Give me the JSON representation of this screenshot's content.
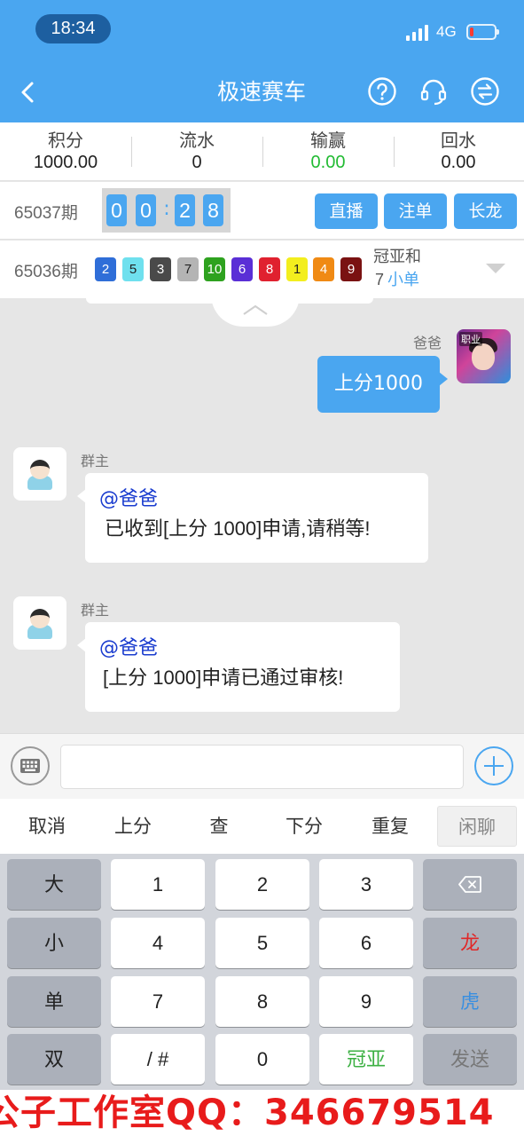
{
  "status_bar": {
    "time": "18:34",
    "network": "4G",
    "battery_level": 0.15
  },
  "header": {
    "title": "极速赛车",
    "icons": [
      "back-icon",
      "help-icon",
      "headset-icon",
      "switch-icon"
    ]
  },
  "stats": [
    {
      "label": "积分",
      "value": "1000.00"
    },
    {
      "label": "流水",
      "value": "0"
    },
    {
      "label": "输赢",
      "value": "0.00"
    },
    {
      "label": "回水",
      "value": "0.00"
    }
  ],
  "current_round": {
    "period": "65037期",
    "countdown": [
      "0",
      "0",
      "2",
      "8"
    ],
    "colon": ":",
    "buttons": [
      "直播",
      "注单",
      "长龙"
    ]
  },
  "last_round": {
    "period": "65036期",
    "balls": [
      {
        "n": "2",
        "color": "#2f6ed8"
      },
      {
        "n": "5",
        "color": "#6fe0ee"
      },
      {
        "n": "3",
        "color": "#4a4a4a"
      },
      {
        "n": "7",
        "color": "#b4b4b4"
      },
      {
        "n": "10",
        "color": "#2ea21f"
      },
      {
        "n": "6",
        "color": "#5a2fd6"
      },
      {
        "n": "8",
        "color": "#e0212f"
      },
      {
        "n": "1",
        "color": "#f3ee1e"
      },
      {
        "n": "4",
        "color": "#f08a14"
      },
      {
        "n": "9",
        "color": "#7a1212"
      }
    ],
    "sum_label": "冠亚和",
    "sum_value": "7",
    "sum_tags": "小单"
  },
  "messages": [
    {
      "sender": "爸爸",
      "side": "right",
      "text": "上分1000"
    },
    {
      "sender": "群主",
      "side": "left",
      "mention": "@爸爸",
      "text": "已收到[上分 1000]申请,请稍等!"
    },
    {
      "sender": "群主",
      "side": "left",
      "mention": "@爸爸",
      "text": "[上分 1000]申请已通过审核!"
    }
  ],
  "avatar_badge": "职业",
  "input": {
    "placeholder": ""
  },
  "quick_actions": [
    "取消",
    "上分",
    "查",
    "下分",
    "重复",
    "闲聊"
  ],
  "keypad": {
    "rows": [
      [
        "大",
        "1",
        "2",
        "3",
        ""
      ],
      [
        "小",
        "4",
        "5",
        "6",
        "龙"
      ],
      [
        "单",
        "7",
        "8",
        "9",
        "虎"
      ],
      [
        "双",
        "/ #",
        "0",
        "冠亚",
        "发送"
      ]
    ]
  },
  "watermark": "公子工作室QQ：346679514",
  "colors": {
    "primary": "#4aa6f0",
    "win_green": "#22bb33",
    "mention_blue": "#1a3ccf",
    "dragon_red": "#e02828",
    "watermark_red": "#e81b1b"
  }
}
